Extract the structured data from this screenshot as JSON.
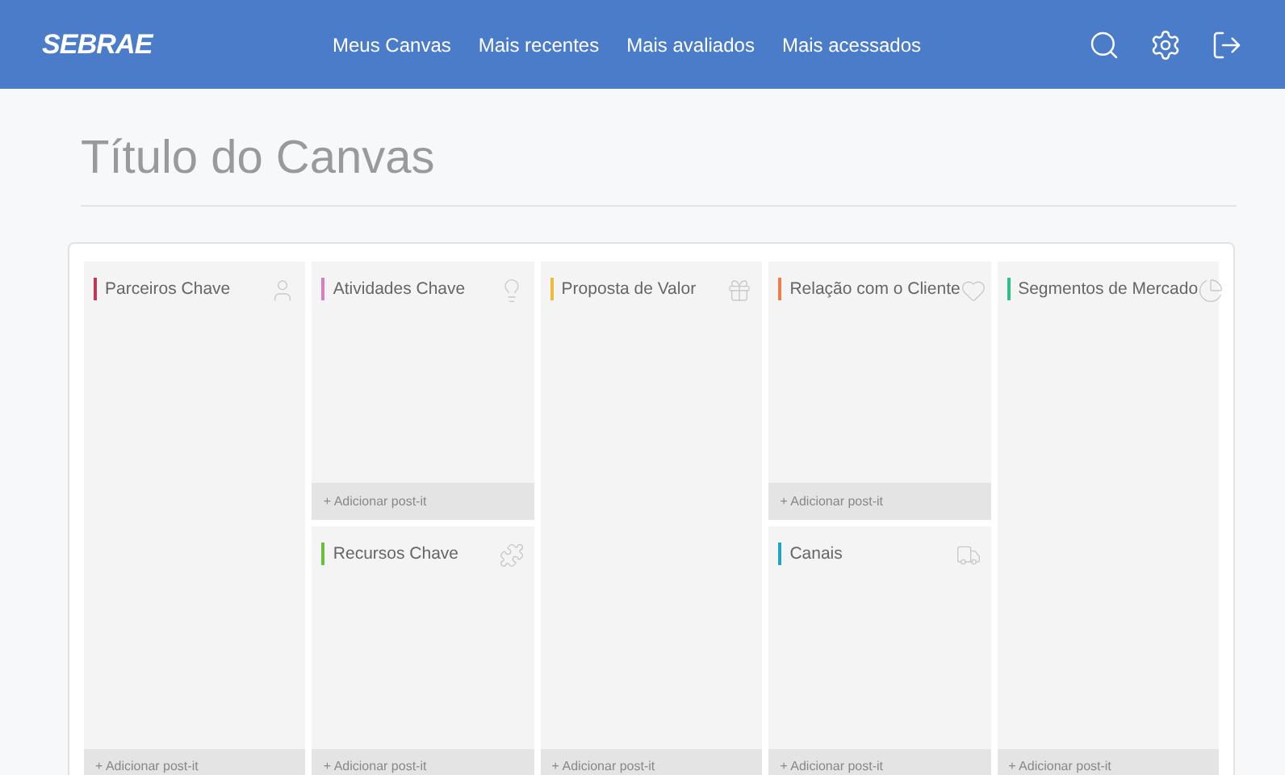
{
  "header": {
    "logo": "SEBRAE",
    "nav": [
      {
        "label": "Meus Canvas"
      },
      {
        "label": "Mais recentes"
      },
      {
        "label": "Mais avaliados"
      },
      {
        "label": "Mais acessados"
      }
    ]
  },
  "page_title": "Título do Canvas",
  "columns": [
    {
      "blocks": [
        {
          "title": "Parceiros Chave",
          "color": "#c0395a",
          "add_label": "+ Adicionar post-it"
        }
      ]
    },
    {
      "blocks": [
        {
          "title": "Atividades Chave",
          "color": "#d47fc0",
          "add_label": "+ Adicionar post-it"
        },
        {
          "title": "Recursos Chave",
          "color": "#6cbf3c",
          "add_label": "+ Adicionar post-it"
        }
      ]
    },
    {
      "blocks": [
        {
          "title": "Proposta de Valor",
          "color": "#f0b93a",
          "add_label": "+ Adicionar post-it"
        }
      ]
    },
    {
      "blocks": [
        {
          "title": "Relação com o Cliente",
          "color": "#ee7d4a",
          "add_label": "+ Adicionar post-it"
        },
        {
          "title": "Canais",
          "color": "#1ea5c4",
          "add_label": "+ Adicionar post-it"
        }
      ]
    },
    {
      "blocks": [
        {
          "title": "Segmentos de Mercado",
          "color": "#2fc08a",
          "add_label": "+ Adicionar post-it"
        }
      ]
    }
  ]
}
